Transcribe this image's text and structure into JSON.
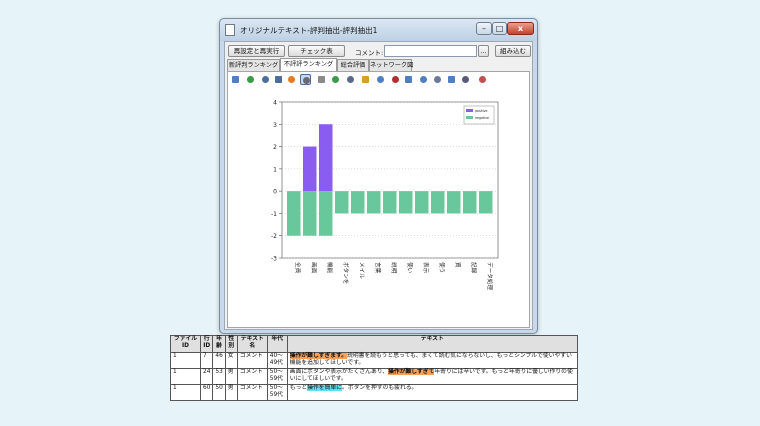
{
  "window": {
    "title": "オリジナルテキスト-評判抽出-評判抽出1",
    "min_label": "–",
    "max_label": "□",
    "close_label": "x"
  },
  "controls": {
    "reset_button": "再設定と再実行",
    "check_button": "チェック表",
    "comment_label": "コメント:",
    "comment_value": "",
    "dots_button": "...",
    "load_button": "組み込む"
  },
  "tabs": [
    {
      "label": "新評判ランキング",
      "active": false
    },
    {
      "label": "不評評ランキング",
      "active": true
    },
    {
      "label": "総合評価",
      "active": false
    },
    {
      "label": "ネットワーク図",
      "active": false
    }
  ],
  "toolbar": {
    "icons": [
      "grid-icon",
      "refresh-icon",
      "zoom-in-icon",
      "zoom-out-icon",
      "home-icon",
      "pointer-icon",
      "pan-icon",
      "add-icon",
      "list-icon",
      "chart-up-icon",
      "scale-icon",
      "text-a-icon",
      "text-b-icon",
      "bar-chart-icon",
      "table-icon",
      "image-icon",
      "pie-icon",
      "search-icon"
    ],
    "colors": [
      "#4f7fc0",
      "#3c9a48",
      "#4b6e9a",
      "#4b6e9a",
      "#e07c28",
      "#6a6a6a",
      "#8a8a8a",
      "#3c9a48",
      "#5a6a8a",
      "#d8a020",
      "#4f7fc0",
      "#b03030",
      "#4f7fc0",
      "#4f7fc0",
      "#6a7a9a",
      "#4f7fc0",
      "#5a5a7a",
      "#c05050"
    ],
    "selected_index": 5
  },
  "chart_data": {
    "type": "bar",
    "stacked": true,
    "categories": [
      "全員",
      "画面",
      "機能",
      "ボタンを",
      "メイル",
      "言葉",
      "説明",
      "使い",
      "表示",
      "使う",
      "買",
      "記録",
      "データ処理"
    ],
    "series": [
      {
        "name": "positive",
        "color": "#8b5cf0",
        "values": [
          0,
          2,
          3,
          0,
          0,
          0,
          0,
          0,
          0,
          0,
          0,
          0,
          0
        ]
      },
      {
        "name": "negative",
        "color": "#68c89c",
        "values": [
          -2,
          -2,
          -2,
          -1,
          -1,
          -1,
          -1,
          -1,
          -1,
          -1,
          -1,
          -1,
          -1
        ]
      }
    ],
    "ylim": [
      -3,
      4
    ],
    "yticks": [
      -3,
      -2,
      -1,
      0,
      1,
      2,
      3,
      4
    ],
    "grid": true,
    "legend": "top-right",
    "title": "",
    "xlabel": "",
    "ylabel": ""
  },
  "table": {
    "headers": [
      "ファイルID",
      "行ID",
      "年齢",
      "性別",
      "テキスト名",
      "年代",
      "テキスト"
    ],
    "rows": [
      {
        "file_id": "1",
        "row_id": "7",
        "age": "46",
        "gender": "女",
        "text_name": "コメント",
        "era": "40～49代",
        "text": [
          {
            "t": "操作が難しすぎます。",
            "hl": "orange"
          },
          {
            "t": "説明書を読もうと思っても、まくて読む気にならないし、もっとシンプルで使いやすい機能を追加してほしいです。",
            "hl": ""
          }
        ]
      },
      {
        "file_id": "1",
        "row_id": "24",
        "age": "53",
        "gender": "男",
        "text_name": "コメント",
        "era": "50～59代",
        "text": [
          {
            "t": "画面にボタンや表示がたくさんあり、",
            "hl": ""
          },
          {
            "t": "操作が難しすぎて",
            "hl": "orange"
          },
          {
            "t": "年寄りには辛いです。もっと年寄りに優しい作りの使いにしてほしいです。",
            "hl": ""
          }
        ]
      },
      {
        "file_id": "1",
        "row_id": "60",
        "age": "50",
        "gender": "男",
        "text_name": "コメント",
        "era": "50～59代",
        "text": [
          {
            "t": "もっと",
            "hl": ""
          },
          {
            "t": "操作を簡単に",
            "hl": "cyan"
          },
          {
            "t": "。ボタンを押すのも疲れる。",
            "hl": ""
          }
        ]
      }
    ]
  }
}
